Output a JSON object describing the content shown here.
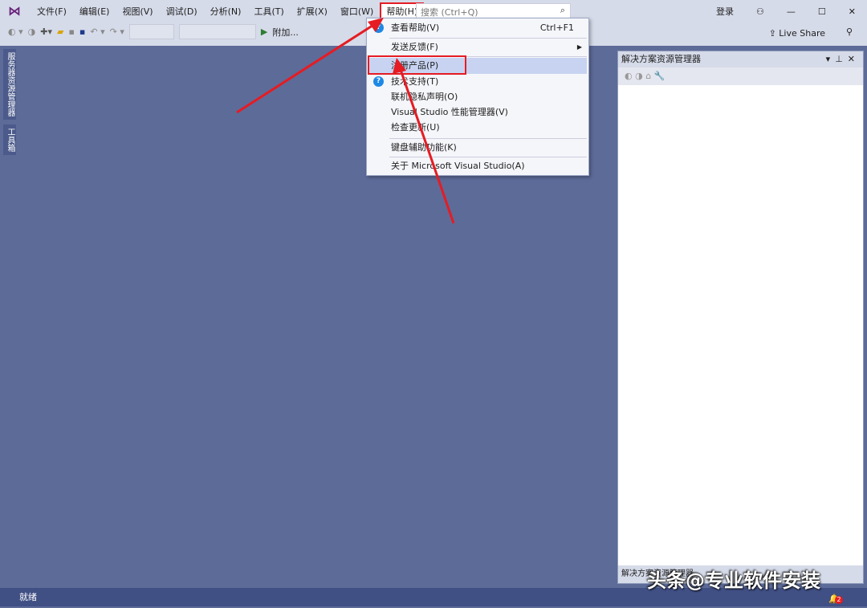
{
  "menubar": {
    "items": [
      "文件(F)",
      "编辑(E)",
      "视图(V)",
      "调试(D)",
      "分析(N)",
      "工具(T)",
      "扩展(X)",
      "窗口(W)",
      "帮助(H)"
    ],
    "active_index": 8
  },
  "search": {
    "placeholder": "搜索 (Ctrl+Q)"
  },
  "account": {
    "signin": "登录"
  },
  "toolbar": {
    "attach": "附加...",
    "live_share": "Live Share"
  },
  "left_tabs": [
    "服务器资源管理器",
    "工具箱"
  ],
  "help_menu": {
    "items": [
      {
        "label": "查看帮助(V)",
        "shortcut": "Ctrl+F1"
      },
      {
        "label": "发送反馈(F)",
        "submenu": true
      },
      {
        "label": "注册产品(P)",
        "highlighted": true
      },
      {
        "label": "技术支持(T)"
      },
      {
        "label": "联机隐私声明(O)"
      },
      {
        "label": "Visual Studio 性能管理器(V)"
      },
      {
        "label": "检查更新(U)"
      },
      {
        "label": "键盘辅助功能(K)"
      },
      {
        "label": "关于 Microsoft Visual Studio(A)"
      }
    ]
  },
  "solution_explorer": {
    "title": "解决方案资源管理器",
    "bottom_tab": "解决方案资源管理器"
  },
  "status": {
    "text": "就绪",
    "notifications": "2"
  },
  "watermark": "头条@专业软件安装",
  "colors": {
    "accent": "#e51c23",
    "background": "#5d6b99"
  }
}
